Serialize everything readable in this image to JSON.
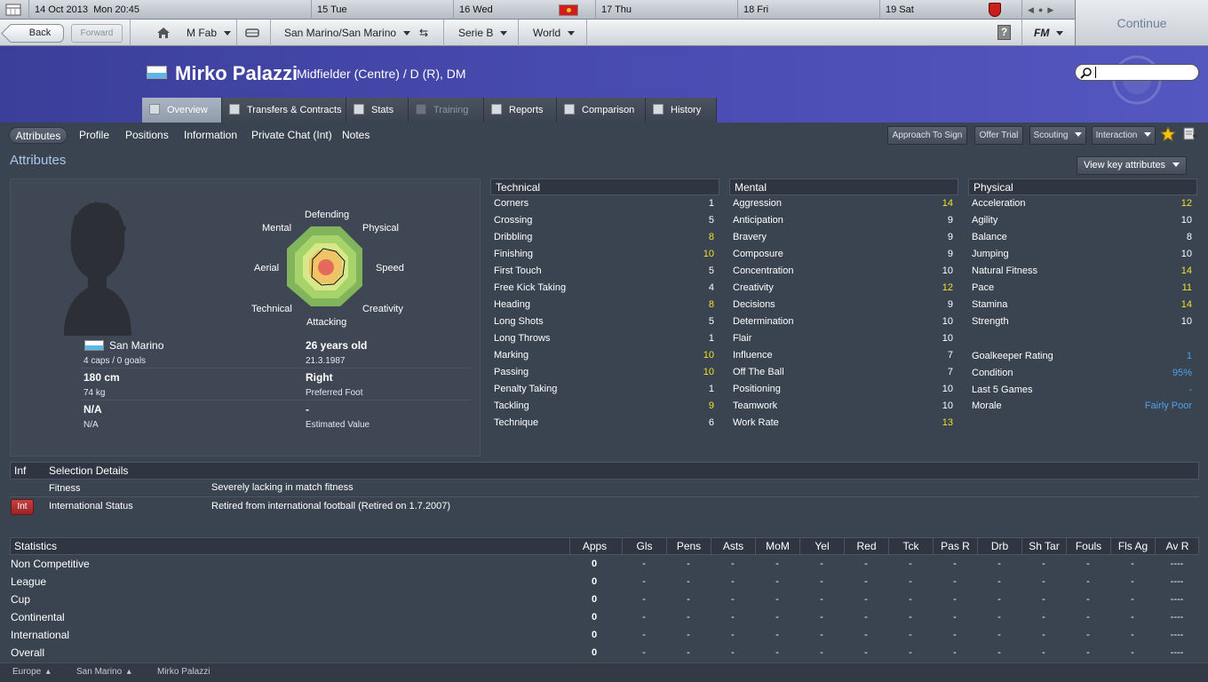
{
  "calendar": {
    "date": "14 Oct 2013",
    "time": "Mon 20:45",
    "days": [
      "15  Tue",
      "16  Wed",
      "17  Thu",
      "18  Fri",
      "19  Sat"
    ]
  },
  "nav": {
    "back": "Back",
    "forward": "Forward",
    "manager": "M Fab",
    "club": "San Marino/San Marino",
    "league": "Serie B",
    "world": "World",
    "help": "?",
    "fm": "FM",
    "continue": "Continue"
  },
  "player": {
    "name": "Mirko Palazzi",
    "position": "Midfielder (Centre) / D (R), DM"
  },
  "tabs": [
    "Overview",
    "Transfers & Contracts",
    "Stats",
    "Training",
    "Reports",
    "Comparison",
    "History"
  ],
  "subnav": {
    "items": [
      "Attributes",
      "Profile",
      "Positions",
      "Information",
      "Private Chat (Int)",
      "Notes"
    ],
    "actions": [
      "Approach To Sign",
      "Offer Trial",
      "Scouting",
      "Interaction"
    ]
  },
  "attributes_title": "Attributes",
  "view_key": "View key attributes",
  "radar": {
    "labels": [
      "Defending",
      "Physical",
      "Speed",
      "Creativity",
      "Attacking",
      "Technical",
      "Aerial",
      "Mental"
    ]
  },
  "bio": {
    "nation": "San Marino",
    "caps": "4 caps / 0 goals",
    "age": "26 years old",
    "dob": "21.3.1987",
    "height": "180 cm",
    "foot": "Right",
    "foot_label": "Preferred Foot",
    "weight": "74 kg",
    "value_main": "N/A",
    "value_sub": "N/A",
    "dash": "-",
    "est_label": "Estimated Value"
  },
  "technical": {
    "title": "Technical",
    "rows": [
      {
        "name": "Corners",
        "value": "1"
      },
      {
        "name": "Crossing",
        "value": "5"
      },
      {
        "name": "Dribbling",
        "value": "8"
      },
      {
        "name": "Finishing",
        "value": "10"
      },
      {
        "name": "First Touch",
        "value": "5"
      },
      {
        "name": "Free Kick Taking",
        "value": "4"
      },
      {
        "name": "Heading",
        "value": "8"
      },
      {
        "name": "Long Shots",
        "value": "5"
      },
      {
        "name": "Long Throws",
        "value": "1"
      },
      {
        "name": "Marking",
        "value": "10"
      },
      {
        "name": "Passing",
        "value": "10"
      },
      {
        "name": "Penalty Taking",
        "value": "1"
      },
      {
        "name": "Tackling",
        "value": "9"
      },
      {
        "name": "Technique",
        "value": "6"
      }
    ]
  },
  "mental": {
    "title": "Mental",
    "rows": [
      {
        "name": "Aggression",
        "value": "14"
      },
      {
        "name": "Anticipation",
        "value": "9"
      },
      {
        "name": "Bravery",
        "value": "9"
      },
      {
        "name": "Composure",
        "value": "9"
      },
      {
        "name": "Concentration",
        "value": "10"
      },
      {
        "name": "Creativity",
        "value": "12"
      },
      {
        "name": "Decisions",
        "value": "9"
      },
      {
        "name": "Determination",
        "value": "10"
      },
      {
        "name": "Flair",
        "value": "10"
      },
      {
        "name": "Influence",
        "value": "7"
      },
      {
        "name": "Off The Ball",
        "value": "7"
      },
      {
        "name": "Positioning",
        "value": "10"
      },
      {
        "name": "Teamwork",
        "value": "10"
      },
      {
        "name": "Work Rate",
        "value": "13"
      }
    ]
  },
  "physical": {
    "title": "Physical",
    "rows": [
      {
        "name": "Acceleration",
        "value": "12"
      },
      {
        "name": "Agility",
        "value": "10"
      },
      {
        "name": "Balance",
        "value": "8"
      },
      {
        "name": "Jumping",
        "value": "10"
      },
      {
        "name": "Natural Fitness",
        "value": "14"
      },
      {
        "name": "Pace",
        "value": "11"
      },
      {
        "name": "Stamina",
        "value": "14"
      },
      {
        "name": "Strength",
        "value": "10"
      }
    ],
    "extra": [
      {
        "name": "Goalkeeper Rating",
        "value": "1"
      },
      {
        "name": "Condition",
        "value": "95%"
      },
      {
        "name": "Last 5 Games",
        "value": "-"
      },
      {
        "name": "Morale",
        "value": "Fairly Poor"
      }
    ]
  },
  "selection": {
    "inf": "Inf",
    "title": "Selection Details",
    "fitness_label": "Fitness",
    "fitness_value": "Severely lacking in match fitness",
    "badge": "Int",
    "intl_label": "International Status",
    "intl_value": "Retired from international football (Retired on 1.7.2007)"
  },
  "statistics": {
    "title": "Statistics",
    "columns": [
      "Apps",
      "Gls",
      "Pens",
      "Asts",
      "MoM",
      "Yel",
      "Red",
      "Tck",
      "Pas R",
      "Drb",
      "Sh Tar",
      "Fouls",
      "Fls Ag",
      "Av R"
    ],
    "rows": [
      {
        "name": "Non Competitive",
        "cells": [
          "0",
          "-",
          "-",
          "-",
          "-",
          "-",
          "-",
          "-",
          "-",
          "-",
          "-",
          "-",
          "-",
          "----"
        ]
      },
      {
        "name": "League",
        "cells": [
          "0",
          "-",
          "-",
          "-",
          "-",
          "-",
          "-",
          "-",
          "-",
          "-",
          "-",
          "-",
          "-",
          "----"
        ]
      },
      {
        "name": "Cup",
        "cells": [
          "0",
          "-",
          "-",
          "-",
          "-",
          "-",
          "-",
          "-",
          "-",
          "-",
          "-",
          "-",
          "-",
          "----"
        ]
      },
      {
        "name": "Continental",
        "cells": [
          "0",
          "-",
          "-",
          "-",
          "-",
          "-",
          "-",
          "-",
          "-",
          "-",
          "-",
          "-",
          "-",
          "----"
        ]
      },
      {
        "name": "International",
        "cells": [
          "0",
          "-",
          "-",
          "-",
          "-",
          "-",
          "-",
          "-",
          "-",
          "-",
          "-",
          "-",
          "-",
          "----"
        ]
      },
      {
        "name": "Overall",
        "cells": [
          "0",
          "-",
          "-",
          "-",
          "-",
          "-",
          "-",
          "-",
          "-",
          "-",
          "-",
          "-",
          "-",
          "----"
        ]
      }
    ]
  },
  "breadcrumbs": [
    "Europe",
    "San Marino",
    "Mirko Palazzi"
  ],
  "colors": {
    "header_blue": "#4a4cb2",
    "highlight_yellow": "#f2e22c",
    "value_blue": "#4fa3e8",
    "title_blue": "#aac8ea"
  }
}
